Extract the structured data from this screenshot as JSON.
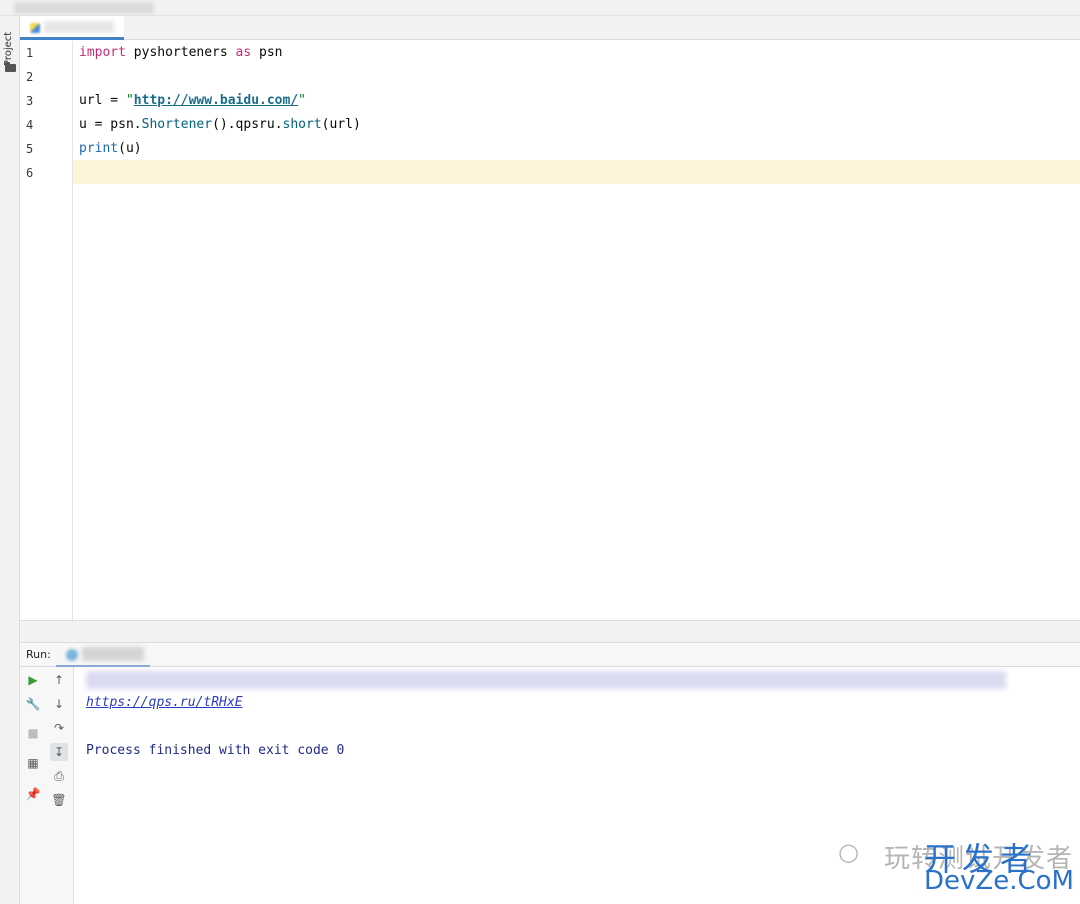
{
  "tool_window": {
    "project_label": "Project"
  },
  "editor": {
    "lines": [
      {
        "num": "1",
        "segments": [
          {
            "t": "import",
            "c": "kw"
          },
          {
            "t": " pyshorteners ",
            "c": "punc"
          },
          {
            "t": "as",
            "c": "kw"
          },
          {
            "t": " psn",
            "c": "punc"
          }
        ]
      },
      {
        "num": "2",
        "segments": []
      },
      {
        "num": "3",
        "segments": [
          {
            "t": "url",
            "c": "punc"
          },
          {
            "t": " = ",
            "c": "punc"
          },
          {
            "t": "\"",
            "c": "str"
          },
          {
            "t": "http://www.baidu.com/",
            "c": "url"
          },
          {
            "t": "\"",
            "c": "str"
          }
        ]
      },
      {
        "num": "4",
        "segments": [
          {
            "t": "u = psn.",
            "c": "punc"
          },
          {
            "t": "Shortener",
            "c": "mth"
          },
          {
            "t": "().qpsru.",
            "c": "punc"
          },
          {
            "t": "short",
            "c": "mth"
          },
          {
            "t": "(url)",
            "c": "punc"
          }
        ]
      },
      {
        "num": "5",
        "segments": [
          {
            "t": "print",
            "c": "bi"
          },
          {
            "t": "(u)",
            "c": "punc"
          }
        ]
      },
      {
        "num": "6",
        "segments": []
      }
    ]
  },
  "run_panel": {
    "label": "Run:",
    "output_link": "https://qps.ru/tRHxE",
    "exit_message": "Process finished with exit code 0"
  },
  "watermark": {
    "wechat_text": "玩转测试开发者",
    "brand_cn": "开发者",
    "brand_en": "DevZe.CoM"
  },
  "colors": {
    "keyword": "#c12d7a",
    "string": "#067d17",
    "current_line": "#fcf5d9",
    "console_link": "#2a3cc4",
    "brand": "#2a72c9"
  }
}
